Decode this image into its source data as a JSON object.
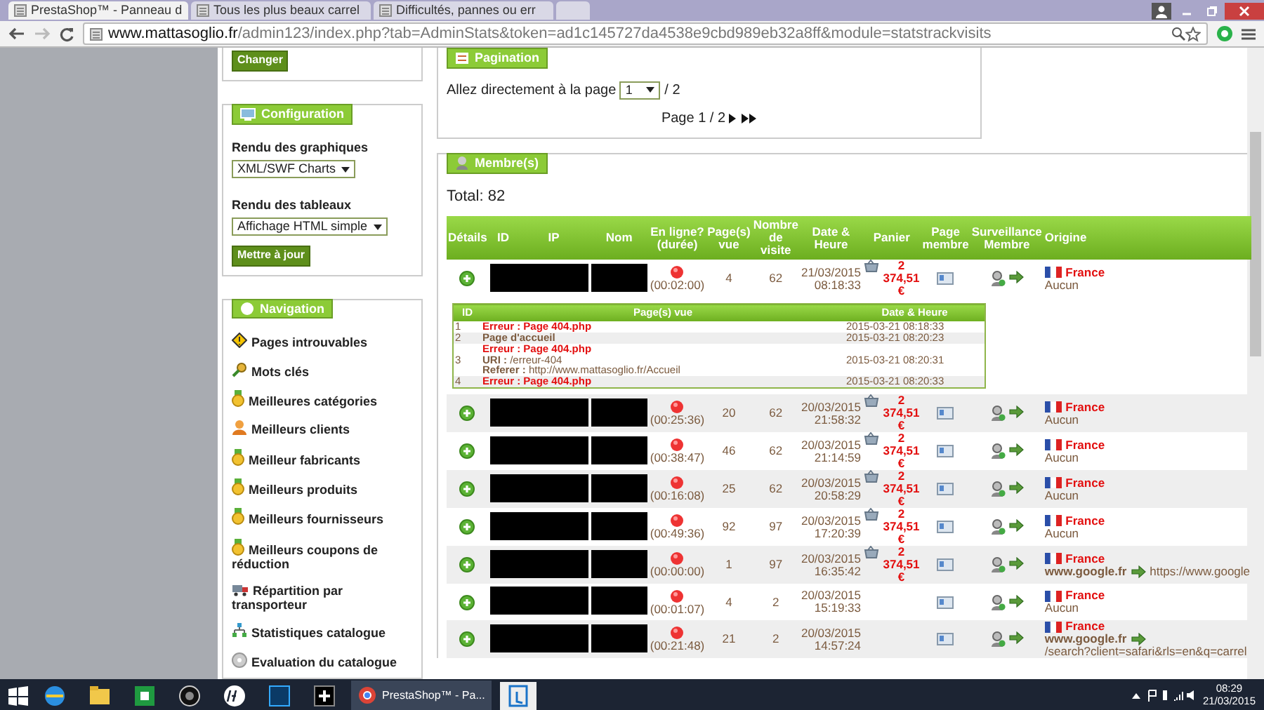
{
  "browser": {
    "tabs": [
      {
        "title": "PrestaShop™ - Panneau d",
        "selected": true
      },
      {
        "title": "Tous les plus beaux carrel",
        "selected": false
      },
      {
        "title": "Difficultés, pannes ou err",
        "selected": false
      }
    ],
    "url_host": "www.mattasoglio.fr",
    "url_path": "/admin123/index.php?tab=AdminStats&token=ad1c145727da4538e9cbd989eb32a8ff&module=statstrackvisits"
  },
  "sidebar": {
    "changer_button": "Changer",
    "configuration": {
      "title": "Configuration",
      "graph_label": "Rendu des graphiques",
      "graph_value": "XML/SWF Charts",
      "table_label": "Rendu des tableaux",
      "table_value": "Affichage HTML simple",
      "button": "Mettre à jour"
    },
    "navigation": {
      "title": "Navigation",
      "items": [
        {
          "label": "Pages introuvables",
          "kind": "warning"
        },
        {
          "label": "Mots clés",
          "kind": "keys"
        },
        {
          "label": "Meilleures catégories",
          "kind": "medal"
        },
        {
          "label": "Meilleurs clients",
          "kind": "person"
        },
        {
          "label": "Meilleur fabricants",
          "kind": "medal"
        },
        {
          "label": "Meilleurs produits",
          "kind": "medal"
        },
        {
          "label": "Meilleurs fournisseurs",
          "kind": "medal"
        },
        {
          "label": "Meilleurs coupons de réduction",
          "kind": "medal"
        },
        {
          "label": "Répartition par transporteur",
          "kind": "truck"
        },
        {
          "label": "Statistiques catalogue",
          "kind": "tree"
        },
        {
          "label": "Evaluation du catalogue",
          "kind": "disc"
        }
      ]
    }
  },
  "pagination": {
    "title": "Pagination",
    "goto_label": "Allez directement à la page",
    "page_value": "1",
    "page_total": "/ 2",
    "page_info": "Page 1 / 2"
  },
  "members": {
    "title": "Membre(s)",
    "total": "Total: 82",
    "columns": [
      "Détails",
      "ID",
      "IP",
      "Nom",
      "En ligne? (durée)",
      "Page(s) vue",
      "Nombre de visite",
      "Date & Heure",
      "Panier",
      "Page membre",
      "Surveillance Membre",
      "Origine"
    ],
    "rows": [
      {
        "expanded": true,
        "duration": "(00:02:00)",
        "pages": "4",
        "visits": "62",
        "date": "21/03/2015",
        "time": "08:18:33",
        "cart": "2 374,51 €",
        "country": "France",
        "origin": "Aucun",
        "referrer": "",
        "details": {
          "columns": [
            "ID",
            "Page(s) vue",
            "Date & Heure"
          ],
          "rows": [
            {
              "id": "1",
              "kind": "error",
              "lines": [
                "Erreur : Page 404.php"
              ],
              "date": "2015-03-21 08:18:33"
            },
            {
              "id": "2",
              "kind": "page",
              "lines": [
                "Page d'accueil"
              ],
              "date": "2015-03-21 08:20:23"
            },
            {
              "id": "3",
              "kind": "error",
              "lines": [
                "Erreur : Page 404.php",
                "**URI :** /erreur-404",
                "**Referer :** http://www.mattasoglio.fr/Accueil"
              ],
              "date": "2015-03-21 08:20:31"
            },
            {
              "id": "4",
              "kind": "error",
              "lines": [
                "Erreur : Page 404.php"
              ],
              "date": "2015-03-21 08:20:33"
            }
          ]
        }
      },
      {
        "expanded": false,
        "duration": "(00:25:36)",
        "pages": "20",
        "visits": "62",
        "date": "20/03/2015",
        "time": "21:58:32",
        "cart": "2 374,51 €",
        "country": "France",
        "origin": "Aucun",
        "referrer": ""
      },
      {
        "expanded": false,
        "duration": "(00:38:47)",
        "pages": "46",
        "visits": "62",
        "date": "20/03/2015",
        "time": "21:14:59",
        "cart": "2 374,51 €",
        "country": "France",
        "origin": "Aucun",
        "referrer": ""
      },
      {
        "expanded": false,
        "duration": "(00:16:08)",
        "pages": "25",
        "visits": "62",
        "date": "20/03/2015",
        "time": "20:58:29",
        "cart": "2 374,51 €",
        "country": "France",
        "origin": "Aucun",
        "referrer": ""
      },
      {
        "expanded": false,
        "duration": "(00:49:36)",
        "pages": "92",
        "visits": "97",
        "date": "20/03/2015",
        "time": "17:20:39",
        "cart": "2 374,51 €",
        "country": "France",
        "origin": "Aucun",
        "referrer": ""
      },
      {
        "expanded": false,
        "duration": "(00:00:00)",
        "pages": "1",
        "visits": "97",
        "date": "20/03/2015",
        "time": "16:35:42",
        "cart": "2 374,51 €",
        "country": "France",
        "origin": "www.google.fr",
        "referrer": "https://www.google"
      },
      {
        "expanded": false,
        "duration": "(00:01:07)",
        "pages": "4",
        "visits": "2",
        "date": "20/03/2015",
        "time": "15:19:33",
        "cart": "",
        "country": "France",
        "origin": "Aucun",
        "referrer": ""
      },
      {
        "expanded": false,
        "duration": "(00:21:48)",
        "pages": "21",
        "visits": "2",
        "date": "20/03/2015",
        "time": "14:57:24",
        "cart": "",
        "country": "France",
        "origin": "www.google.fr",
        "referrer": "/search?client=safari&rls=en&q=carrel"
      }
    ]
  },
  "taskbar": {
    "app_title": "PrestaShop™ - Pa...",
    "time": "08:29",
    "date": "21/03/2015"
  }
}
